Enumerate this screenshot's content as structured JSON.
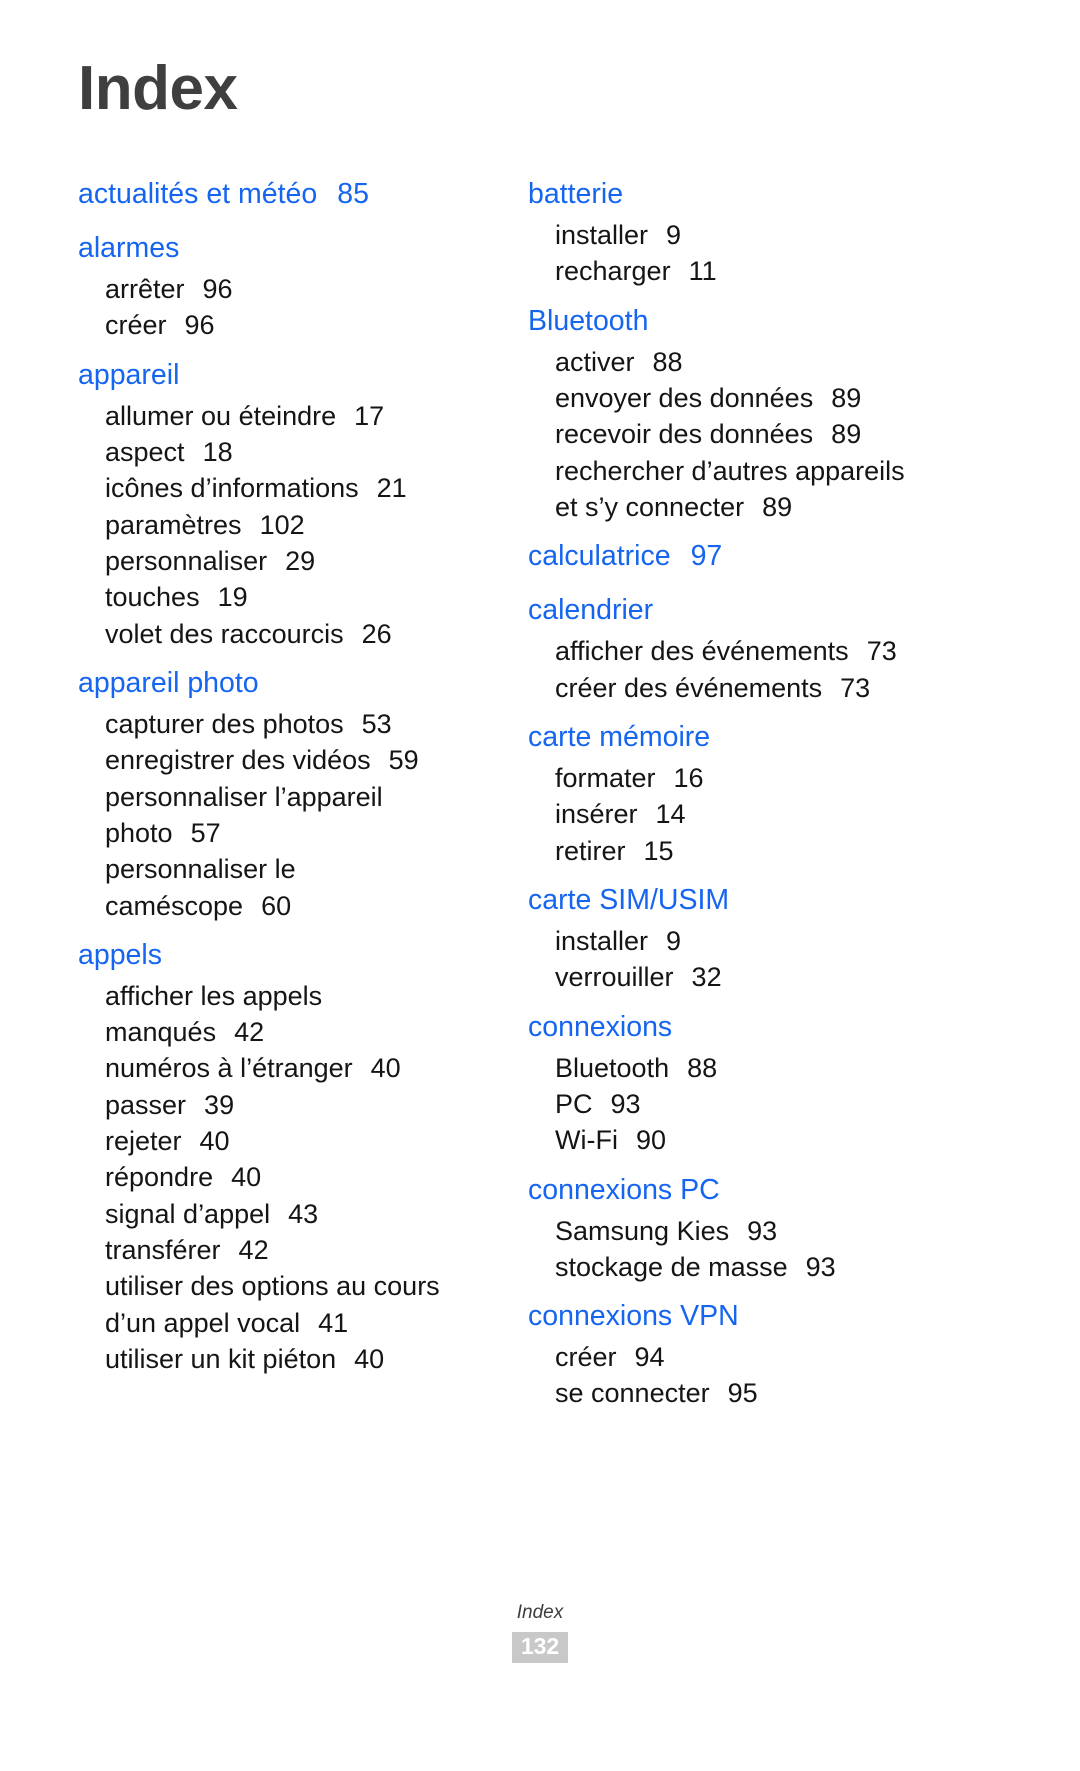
{
  "page": {
    "title": "Index",
    "accent_color": "#1565f0",
    "text_color": "#151515",
    "title_color": "#3f3f3f"
  },
  "footer": {
    "label": "Index",
    "page_number": "132",
    "badge_color": "#c8c8c8"
  },
  "columns": [
    {
      "id": "left",
      "groups": [
        {
          "heading": "actualités et météo",
          "page": "85",
          "items": []
        },
        {
          "heading": "alarmes",
          "page": "",
          "items": [
            {
              "label": "arrêter",
              "page": "96"
            },
            {
              "label": "créer",
              "page": "96"
            }
          ]
        },
        {
          "heading": "appareil",
          "page": "",
          "items": [
            {
              "label": "allumer ou éteindre",
              "page": "17"
            },
            {
              "label": "aspect",
              "page": "18"
            },
            {
              "label": "icônes d’informations",
              "page": "21"
            },
            {
              "label": "paramètres",
              "page": "102"
            },
            {
              "label": "personnaliser",
              "page": "29"
            },
            {
              "label": "touches",
              "page": "19"
            },
            {
              "label": "volet des raccourcis",
              "page": "26"
            }
          ]
        },
        {
          "heading": "appareil photo",
          "page": "",
          "items": [
            {
              "label": "capturer des photos",
              "page": "53"
            },
            {
              "label": "enregistrer des vidéos",
              "page": "59"
            },
            {
              "label": "personnaliser l’appareil",
              "page": ""
            },
            {
              "label": "photo",
              "page": "57"
            },
            {
              "label": "personnaliser le",
              "page": ""
            },
            {
              "label": "caméscope",
              "page": "60"
            }
          ]
        },
        {
          "heading": "appels",
          "page": "",
          "items": [
            {
              "label": "afficher les appels",
              "page": ""
            },
            {
              "label": "manqués",
              "page": "42"
            },
            {
              "label": "numéros à l’étranger",
              "page": "40"
            },
            {
              "label": "passer",
              "page": "39"
            },
            {
              "label": "rejeter",
              "page": "40"
            },
            {
              "label": "répondre",
              "page": "40"
            },
            {
              "label": "signal d’appel",
              "page": "43"
            },
            {
              "label": "transférer",
              "page": "42"
            },
            {
              "label": "utiliser des options au cours",
              "page": ""
            },
            {
              "label": "d’un appel vocal",
              "page": "41"
            },
            {
              "label": "utiliser un kit piéton",
              "page": "40"
            }
          ]
        }
      ]
    },
    {
      "id": "right",
      "groups": [
        {
          "heading": "batterie",
          "page": "",
          "items": [
            {
              "label": "installer",
              "page": "9"
            },
            {
              "label": "recharger",
              "page": "11"
            }
          ]
        },
        {
          "heading": "Bluetooth",
          "page": "",
          "items": [
            {
              "label": "activer",
              "page": "88"
            },
            {
              "label": "envoyer des données",
              "page": "89"
            },
            {
              "label": "recevoir des données",
              "page": "89"
            },
            {
              "label": "rechercher d’autres appareils",
              "page": ""
            },
            {
              "label": "et s’y connecter",
              "page": "89"
            }
          ]
        },
        {
          "heading": "calculatrice",
          "page": "97",
          "items": []
        },
        {
          "heading": "calendrier",
          "page": "",
          "items": [
            {
              "label": "afficher des événements",
              "page": "73"
            },
            {
              "label": "créer des événements",
              "page": "73"
            }
          ]
        },
        {
          "heading": "carte mémoire",
          "page": "",
          "items": [
            {
              "label": "formater",
              "page": "16"
            },
            {
              "label": "insérer",
              "page": "14"
            },
            {
              "label": "retirer",
              "page": "15"
            }
          ]
        },
        {
          "heading": "carte SIM/USIM",
          "page": "",
          "items": [
            {
              "label": "installer",
              "page": "9"
            },
            {
              "label": "verrouiller",
              "page": "32"
            }
          ]
        },
        {
          "heading": "connexions",
          "page": "",
          "items": [
            {
              "label": "Bluetooth",
              "page": "88"
            },
            {
              "label": "PC",
              "page": "93"
            },
            {
              "label": "Wi-Fi",
              "page": "90"
            }
          ]
        },
        {
          "heading": "connexions PC",
          "page": "",
          "items": [
            {
              "label": "Samsung Kies",
              "page": "93"
            },
            {
              "label": "stockage de masse",
              "page": "93"
            }
          ]
        },
        {
          "heading": "connexions VPN",
          "page": "",
          "items": [
            {
              "label": "créer",
              "page": "94"
            },
            {
              "label": "se connecter",
              "page": "95"
            }
          ]
        }
      ]
    }
  ]
}
